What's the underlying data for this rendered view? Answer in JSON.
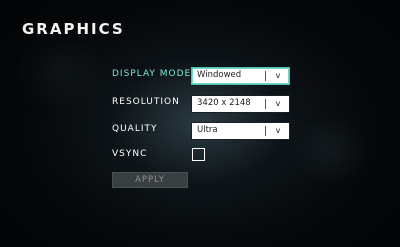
{
  "title": "GRAPHICS",
  "settings": {
    "display_mode": {
      "label": "DISPLAY MODE",
      "value": "Windowed",
      "chevron": "v"
    },
    "resolution": {
      "label": "RESOLUTION",
      "value": "3420 x 2148",
      "chevron": "v"
    },
    "quality": {
      "label": "QUALITY",
      "value": "Ultra",
      "chevron": "v"
    },
    "vsync": {
      "label": "VSYNC",
      "checked": false
    }
  },
  "apply_label": "APPLY",
  "colors": {
    "accent": "#7de8d8",
    "text": "#ffffff",
    "disabled_button": "#3a3f42"
  },
  "icons": {
    "dropdown": "chevron-down-icon"
  }
}
